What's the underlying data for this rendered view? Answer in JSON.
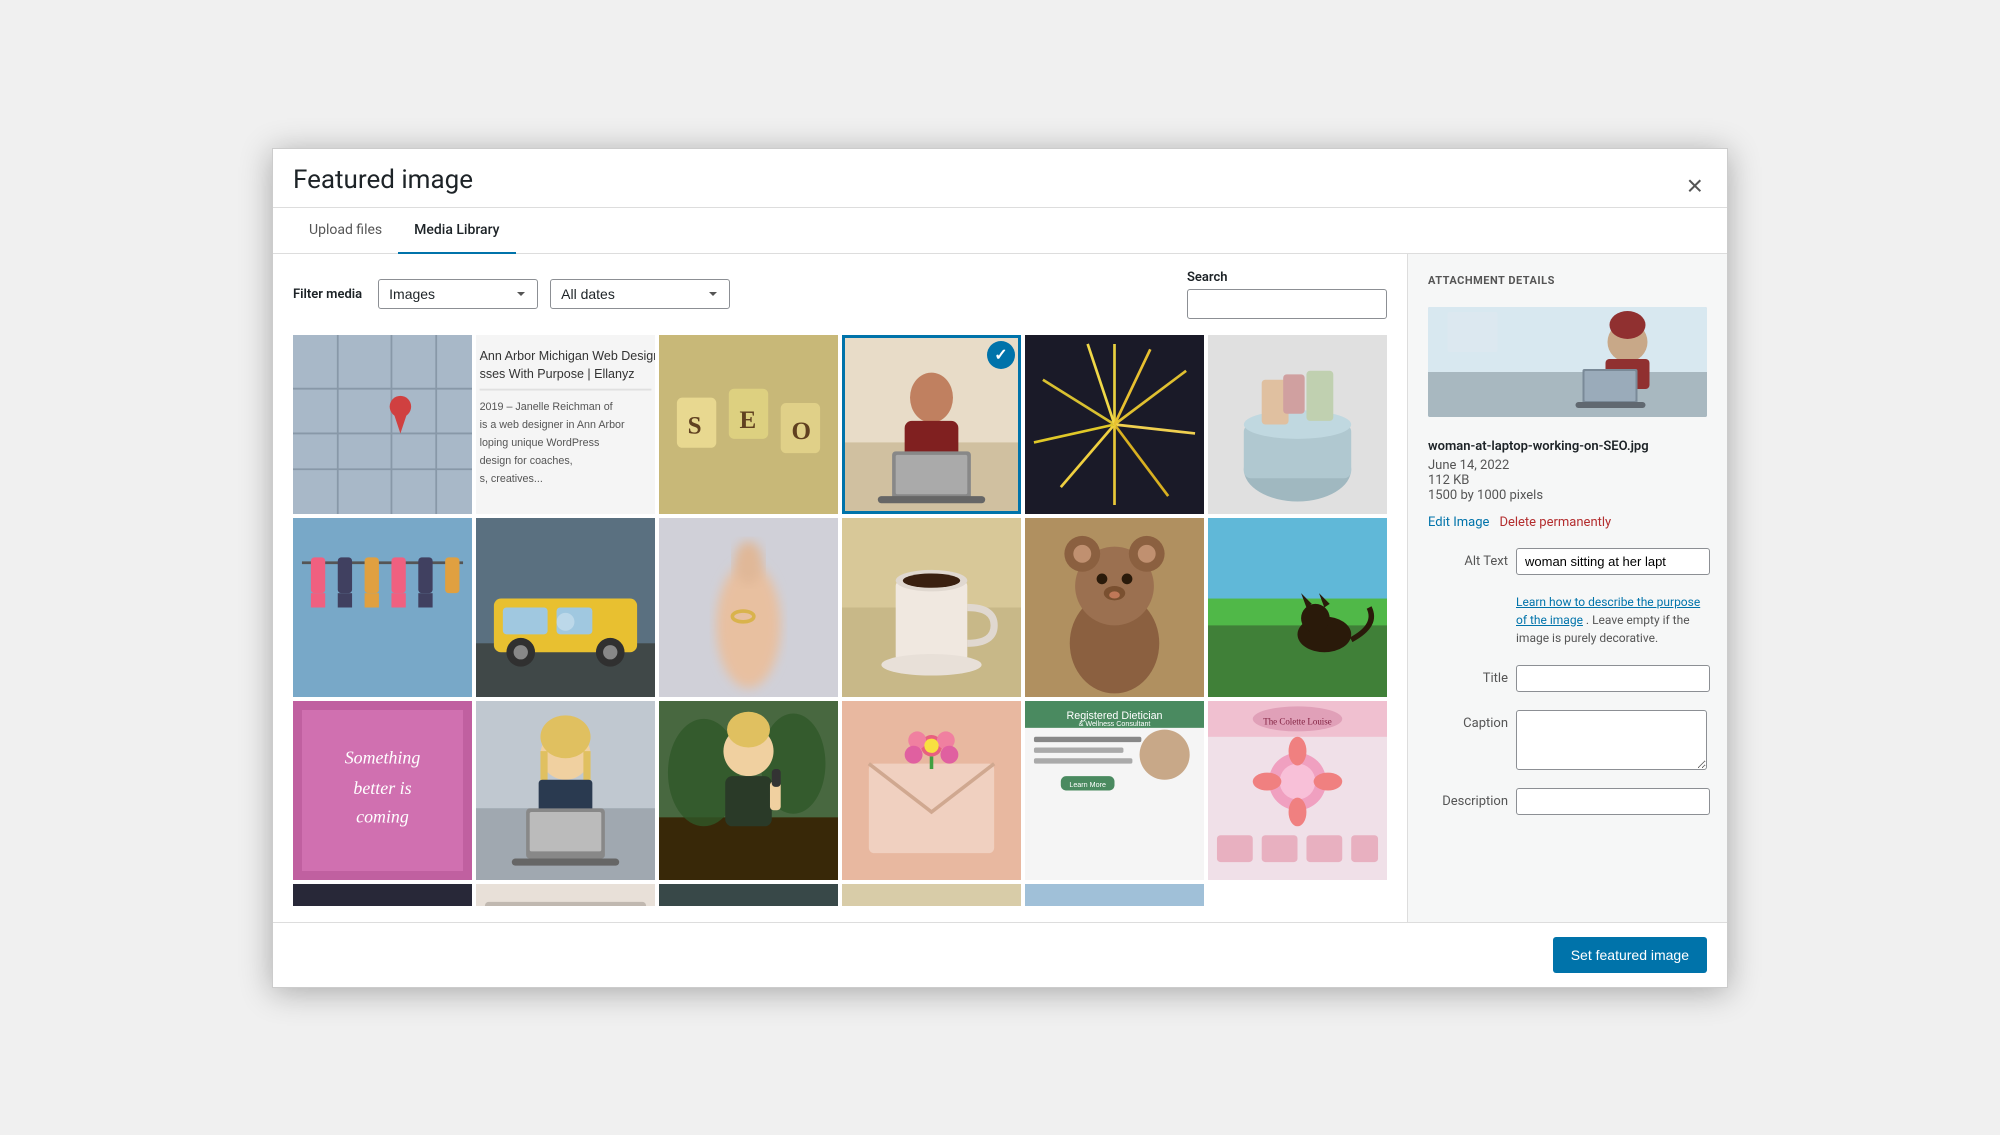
{
  "modal": {
    "title": "Featured image",
    "close_label": "×"
  },
  "tabs": [
    {
      "id": "upload",
      "label": "Upload files",
      "active": false
    },
    {
      "id": "library",
      "label": "Media Library",
      "active": true
    }
  ],
  "filter": {
    "label": "Filter media",
    "type_label": "Images",
    "date_label": "All dates",
    "search_label": "Search",
    "search_placeholder": ""
  },
  "attachment_details": {
    "section_title": "ATTACHMENT DETAILS",
    "filename": "woman-at-laptop-working-on-SEO.jpg",
    "date": "June 14, 2022",
    "filesize": "112 KB",
    "dimensions": "1500 by 1000 pixels",
    "edit_label": "Edit Image",
    "delete_label": "Delete permanently",
    "alt_text_label": "Alt Text",
    "alt_text_value": "woman sitting at her lapt",
    "alt_text_note_prefix": "",
    "alt_text_link": "Learn how to describe the purpose of the image",
    "alt_text_note_suffix": ". Leave empty if the image is purely decorative.",
    "title_label": "Title",
    "title_value": "",
    "caption_label": "Caption",
    "caption_value": "",
    "description_label": "Description",
    "description_value": ""
  },
  "footer": {
    "set_button_label": "Set featured image"
  },
  "media_grid": {
    "items": [
      {
        "id": 1,
        "color": "#a8b8c8",
        "row": 1,
        "selected": false
      },
      {
        "id": 2,
        "color": "#d0c8e0",
        "row": 1,
        "selected": false
      },
      {
        "id": 3,
        "color": "#b8a870",
        "row": 1,
        "selected": false
      },
      {
        "id": 4,
        "color": "#e8d0b8",
        "row": 1,
        "selected": true
      },
      {
        "id": 5,
        "color": "#303048",
        "row": 1,
        "selected": false
      },
      {
        "id": 6,
        "color": "#c0c8d0",
        "row": 1,
        "selected": false
      },
      {
        "id": 7,
        "color": "#a0b8d0",
        "row": 2,
        "selected": false
      },
      {
        "id": 8,
        "color": "#e8c050",
        "row": 2,
        "selected": false
      },
      {
        "id": 9,
        "color": "#d8d8e8",
        "row": 2,
        "selected": false
      },
      {
        "id": 10,
        "color": "#c8a870",
        "row": 2,
        "selected": false
      },
      {
        "id": 11,
        "color": "#c09060",
        "row": 2,
        "selected": false
      },
      {
        "id": 12,
        "color": "#70a860",
        "row": 2,
        "selected": false
      },
      {
        "id": 13,
        "color": "#c060a0",
        "row": 3,
        "selected": false
      },
      {
        "id": 14,
        "color": "#90a0b8",
        "row": 3,
        "selected": false
      },
      {
        "id": 15,
        "color": "#507848",
        "row": 3,
        "selected": false
      },
      {
        "id": 16,
        "color": "#e8b8b0",
        "row": 3,
        "selected": false
      },
      {
        "id": 17,
        "color": "#d0d8e0",
        "row": 3,
        "selected": false
      },
      {
        "id": 18,
        "color": "#e8b0c0",
        "row": 3,
        "selected": false
      },
      {
        "id": 19,
        "color": "#404048",
        "row": 4,
        "selected": false
      },
      {
        "id": 20,
        "color": "#d0c8c0",
        "row": 4,
        "selected": false
      },
      {
        "id": 21,
        "color": "#405050",
        "row": 4,
        "selected": false
      }
    ]
  }
}
